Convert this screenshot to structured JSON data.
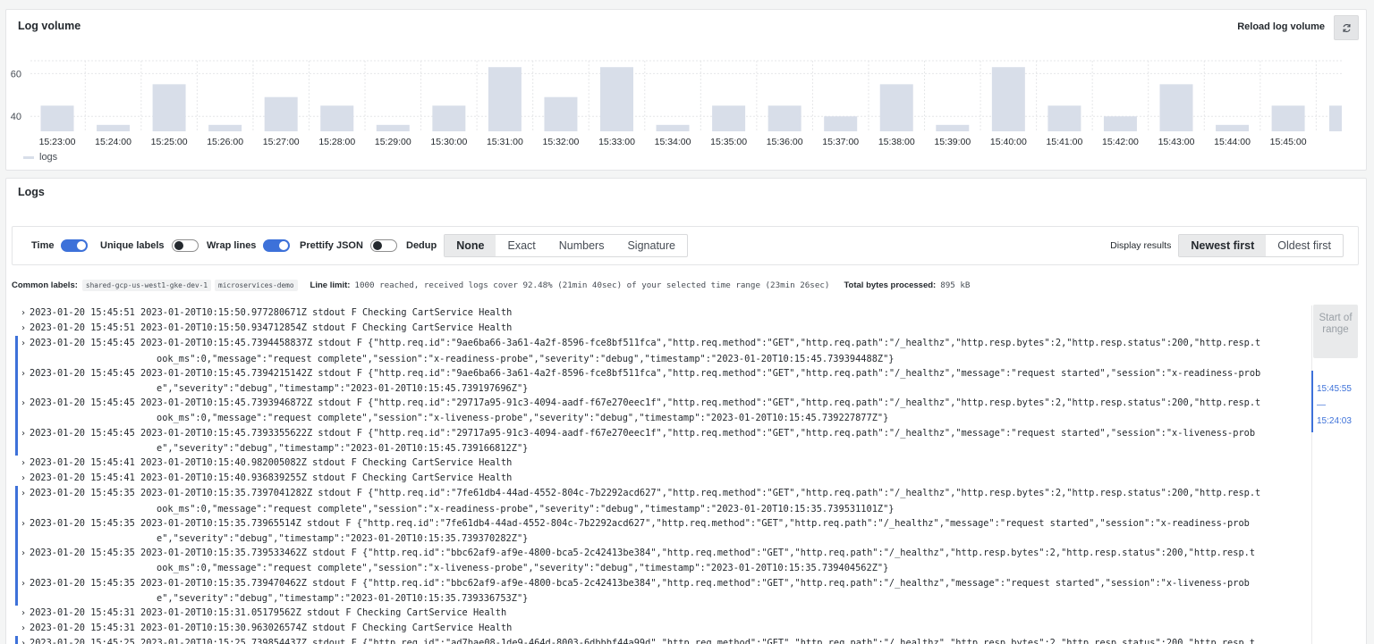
{
  "log_volume": {
    "title": "Log volume",
    "reload_label": "Reload log volume",
    "reload_icon": "refresh-icon",
    "legend": "logs"
  },
  "chart_data": {
    "type": "bar",
    "categories": [
      "15:23:00",
      "15:24:00",
      "15:25:00",
      "15:26:00",
      "15:27:00",
      "15:28:00",
      "15:29:00",
      "15:30:00",
      "15:31:00",
      "15:32:00",
      "15:33:00",
      "15:34:00",
      "15:35:00",
      "15:36:00",
      "15:37:00",
      "15:38:00",
      "15:39:00",
      "15:40:00",
      "15:41:00",
      "15:42:00",
      "15:43:00",
      "15:44:00",
      "15:45:00"
    ],
    "series": [
      {
        "name": "logs",
        "values": [
          45,
          36,
          55,
          36,
          49,
          45,
          36,
          45,
          63,
          49,
          63,
          36,
          45,
          45,
          40,
          55,
          36,
          63,
          45,
          40,
          55,
          36,
          45
        ]
      }
    ],
    "y_ticks": [
      40,
      60
    ],
    "ylim": [
      33,
      66
    ],
    "grid": true,
    "legend_placement": "bottom-left",
    "color": "#d8dee9"
  },
  "logs": {
    "title": "Logs",
    "options": {
      "time_label": "Time",
      "unique_labels_label": "Unique labels",
      "wrap_lines_label": "Wrap lines",
      "prettify_json_label": "Prettify JSON",
      "dedup_label": "Dedup",
      "dedup_options": [
        "None",
        "Exact",
        "Numbers",
        "Signature"
      ],
      "display_results_label": "Display results",
      "order_options": [
        "Newest first",
        "Oldest first"
      ]
    },
    "meta": {
      "common_labels_label": "Common labels:",
      "common_labels": [
        "shared-gcp-us-west1-gke-dev-1",
        "microservices-demo"
      ],
      "line_limit_label": "Line limit:",
      "line_limit_value": "1000 reached, received logs cover 92.48% (21min 40sec) of your selected time range (23min 26sec)",
      "bytes_label": "Total bytes processed:",
      "bytes_value": "895 kB"
    },
    "rows": [
      {
        "ts": "2023-01-20 15:45:51",
        "line1": "2023-01-20T10:15:50.977280671Z stdout F Checking CartService Health",
        "line2": ""
      },
      {
        "ts": "2023-01-20 15:45:51",
        "line1": "2023-01-20T10:15:50.934712854Z stdout F Checking CartService Health",
        "line2": ""
      },
      {
        "ts": "2023-01-20 15:45:45",
        "line1": "2023-01-20T10:15:45.7394458837Z stdout F {\"http.req.id\":\"9ae6ba66-3a61-4a2f-8596-fce8bf511fca\",\"http.req.method\":\"GET\",\"http.req.path\":\"/_healthz\",\"http.resp.bytes\":2,\"http.resp.status\":200,\"http.resp.t",
        "line2": "ook_ms\":0,\"message\":\"request complete\",\"session\":\"x-readiness-probe\",\"severity\":\"debug\",\"timestamp\":\"2023-01-20T10:15:45.739394488Z\"}"
      },
      {
        "ts": "2023-01-20 15:45:45",
        "line1": "2023-01-20T10:15:45.7394215142Z stdout F {\"http.req.id\":\"9ae6ba66-3a61-4a2f-8596-fce8bf511fca\",\"http.req.method\":\"GET\",\"http.req.path\":\"/_healthz\",\"message\":\"request started\",\"session\":\"x-readiness-prob",
        "line2": "e\",\"severity\":\"debug\",\"timestamp\":\"2023-01-20T10:15:45.739197696Z\"}"
      },
      {
        "ts": "2023-01-20 15:45:45",
        "line1": "2023-01-20T10:15:45.7393946872Z stdout F {\"http.req.id\":\"29717a95-91c3-4094-aadf-f67e270eec1f\",\"http.req.method\":\"GET\",\"http.req.path\":\"/_healthz\",\"http.resp.bytes\":2,\"http.resp.status\":200,\"http.resp.t",
        "line2": "ook_ms\":0,\"message\":\"request complete\",\"session\":\"x-liveness-probe\",\"severity\":\"debug\",\"timestamp\":\"2023-01-20T10:15:45.739227877Z\"}"
      },
      {
        "ts": "2023-01-20 15:45:45",
        "line1": "2023-01-20T10:15:45.7393355622Z stdout F {\"http.req.id\":\"29717a95-91c3-4094-aadf-f67e270eec1f\",\"http.req.method\":\"GET\",\"http.req.path\":\"/_healthz\",\"message\":\"request started\",\"session\":\"x-liveness-prob",
        "line2": "e\",\"severity\":\"debug\",\"timestamp\":\"2023-01-20T10:15:45.739166812Z\"}"
      },
      {
        "ts": "2023-01-20 15:45:41",
        "line1": "2023-01-20T10:15:40.982005082Z stdout F Checking CartService Health",
        "line2": ""
      },
      {
        "ts": "2023-01-20 15:45:41",
        "line1": "2023-01-20T10:15:40.936839255Z stdout F Checking CartService Health",
        "line2": ""
      },
      {
        "ts": "2023-01-20 15:45:35",
        "line1": "2023-01-20T10:15:35.7397041282Z stdout F {\"http.req.id\":\"7fe61db4-44ad-4552-804c-7b2292acd627\",\"http.req.method\":\"GET\",\"http.req.path\":\"/_healthz\",\"http.resp.bytes\":2,\"http.resp.status\":200,\"http.resp.t",
        "line2": "ook_ms\":0,\"message\":\"request complete\",\"session\":\"x-readiness-probe\",\"severity\":\"debug\",\"timestamp\":\"2023-01-20T10:15:35.739531101Z\"}"
      },
      {
        "ts": "2023-01-20 15:45:35",
        "line1": "2023-01-20T10:15:35.73965514Z stdout F {\"http.req.id\":\"7fe61db4-44ad-4552-804c-7b2292acd627\",\"http.req.method\":\"GET\",\"http.req.path\":\"/_healthz\",\"message\":\"request started\",\"session\":\"x-readiness-prob",
        "line2": "e\",\"severity\":\"debug\",\"timestamp\":\"2023-01-20T10:15:35.739370282Z\"}"
      },
      {
        "ts": "2023-01-20 15:45:35",
        "line1": "2023-01-20T10:15:35.739533462Z stdout F {\"http.req.id\":\"bbc62af9-af9e-4800-bca5-2c42413be384\",\"http.req.method\":\"GET\",\"http.req.path\":\"/_healthz\",\"http.resp.bytes\":2,\"http.resp.status\":200,\"http.resp.t",
        "line2": "ook_ms\":0,\"message\":\"request complete\",\"session\":\"x-liveness-probe\",\"severity\":\"debug\",\"timestamp\":\"2023-01-20T10:15:35.739404562Z\"}"
      },
      {
        "ts": "2023-01-20 15:45:35",
        "line1": "2023-01-20T10:15:35.739470462Z stdout F {\"http.req.id\":\"bbc62af9-af9e-4800-bca5-2c42413be384\",\"http.req.method\":\"GET\",\"http.req.path\":\"/_healthz\",\"message\":\"request started\",\"session\":\"x-liveness-prob",
        "line2": "e\",\"severity\":\"debug\",\"timestamp\":\"2023-01-20T10:15:35.739336753Z\"}"
      },
      {
        "ts": "2023-01-20 15:45:31",
        "line1": "2023-01-20T10:15:31.05179562Z stdout F Checking CartService Health",
        "line2": ""
      },
      {
        "ts": "2023-01-20 15:45:31",
        "line1": "2023-01-20T10:15:30.963026574Z stdout F Checking CartService Health",
        "line2": ""
      },
      {
        "ts": "2023-01-20 15:45:25",
        "line1": "2023-01-20T10:15:25.739854437Z stdout F {\"http.req.id\":\"ad7bae08-1de9-464d-8003-6dbbbf44a99d\",\"http.req.method\":\"GET\",\"http.req.path\":\"/_healthz\",\"http.resp.bytes\":2,\"http.resp.status\":200,\"http.resp.t",
        "line2": ""
      }
    ],
    "range": {
      "start_label": "Start of range",
      "top": "15:45:55",
      "sep": "—",
      "bottom": "15:24:03"
    }
  }
}
